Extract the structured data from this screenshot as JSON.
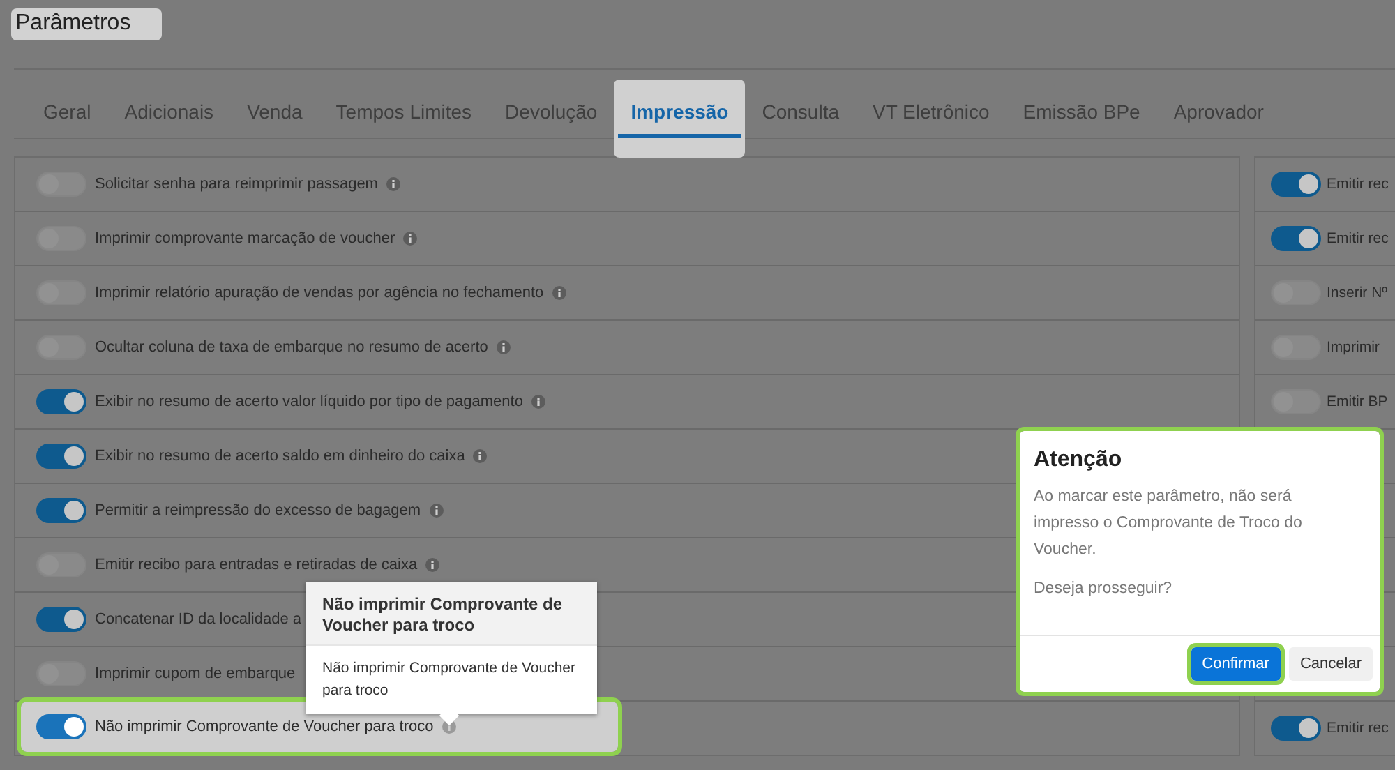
{
  "title": "Parâmetros",
  "tabs": [
    {
      "label": "Geral",
      "selected": false
    },
    {
      "label": "Adicionais",
      "selected": false
    },
    {
      "label": "Venda",
      "selected": false
    },
    {
      "label": "Tempos Limites",
      "selected": false
    },
    {
      "label": "Devolução",
      "selected": false
    },
    {
      "label": "Impressão",
      "selected": true
    },
    {
      "label": "Consulta",
      "selected": false
    },
    {
      "label": "VT Eletrônico",
      "selected": false
    },
    {
      "label": "Emissão BPe",
      "selected": false
    },
    {
      "label": "Aprovador",
      "selected": false
    }
  ],
  "left_options": [
    {
      "label": "Solicitar senha para reimprimir passagem",
      "on": false,
      "highlighted": false
    },
    {
      "label": "Imprimir comprovante marcação de voucher",
      "on": false,
      "highlighted": false
    },
    {
      "label": "Imprimir relatório apuração de vendas por agência no fechamento",
      "on": false,
      "highlighted": false
    },
    {
      "label": "Ocultar coluna de taxa de embarque no resumo de acerto",
      "on": false,
      "highlighted": false
    },
    {
      "label": "Exibir no resumo de acerto valor líquido por tipo de pagamento",
      "on": true,
      "highlighted": false
    },
    {
      "label": "Exibir no resumo de acerto saldo em dinheiro do caixa",
      "on": true,
      "highlighted": false
    },
    {
      "label": "Permitir a reimpressão do excesso de bagagem",
      "on": true,
      "highlighted": false
    },
    {
      "label": "Emitir recibo para entradas e retiradas de caixa",
      "on": false,
      "highlighted": false
    },
    {
      "label": "Concatenar ID da localidade a",
      "on": true,
      "highlighted": false
    },
    {
      "label": "Imprimir cupom de embarque",
      "on": false,
      "highlighted": false
    },
    {
      "label": "Não imprimir Comprovante de Voucher para troco",
      "on": true,
      "highlighted": true
    }
  ],
  "right_options_top": [
    {
      "label": "Emitir rec",
      "on": true
    },
    {
      "label": "Emitir rec",
      "on": true
    },
    {
      "label": "Inserir Nº",
      "on": false
    },
    {
      "label": "Imprimir",
      "on": false
    },
    {
      "label": "Emitir BP",
      "on": false
    }
  ],
  "right_options_bottom": [
    {
      "label": "Emitir rec",
      "on": true
    }
  ],
  "tooltip": {
    "title": "Não imprimir Comprovante de Voucher para troco",
    "body": "Não imprimir Comprovante de Voucher para troco"
  },
  "dialog": {
    "title": "Atenção",
    "message": "Ao marcar este parâmetro, não será impresso o Comprovante de Troco do Voucher.",
    "question": "Deseja prosseguir?",
    "buttons": [
      {
        "label": "Confirmar",
        "kind": "primary"
      },
      {
        "label": "Cancelar",
        "kind": "secondary"
      }
    ]
  }
}
